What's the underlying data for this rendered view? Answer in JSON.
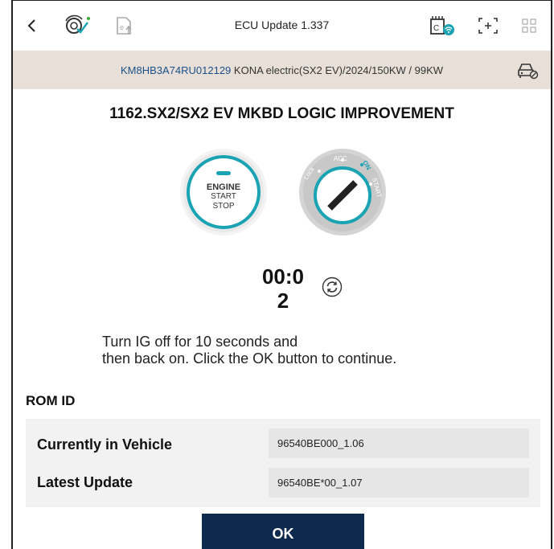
{
  "header": {
    "title": "ECU Update 1.337",
    "icons": [
      "back-icon",
      "diagnostic-check-icon",
      "export-icon",
      "vci-wifi-icon",
      "screen-capture-icon",
      "grid-menu-icon"
    ]
  },
  "vehicle": {
    "vin": "KM8HB3A74RU012129",
    "description": "KONA electric(SX2 EV)/2024/150KW / 99KW"
  },
  "ecu": {
    "title": "1162.SX2/SX2 EV MKBD LOGIC IMPROVEMENT"
  },
  "engine_button": {
    "line1": "ENGINE",
    "line2": "START",
    "line3": "STOP"
  },
  "ignition": {
    "lock": "Lock",
    "acc": "ACC",
    "on": "ON",
    "start": "START"
  },
  "timer": {
    "line1": "00:0",
    "line2": "2"
  },
  "instruction": {
    "line1": "Turn IG off for 10 seconds and",
    "line2": "then back on. Click the OK button to continue."
  },
  "rom": {
    "heading": "ROM ID",
    "rows": [
      {
        "label": "Currently in Vehicle",
        "value": "96540BE000_1.06"
      },
      {
        "label": "Latest Update",
        "value": "96540BE*00_1.07"
      }
    ]
  },
  "buttons": {
    "ok": "OK"
  },
  "colors": {
    "vin_bar": "#e8e0d8",
    "vin_text": "#1a4f8a",
    "accent_teal": "#1aa3b3",
    "ok_button": "#0d2a4e"
  }
}
